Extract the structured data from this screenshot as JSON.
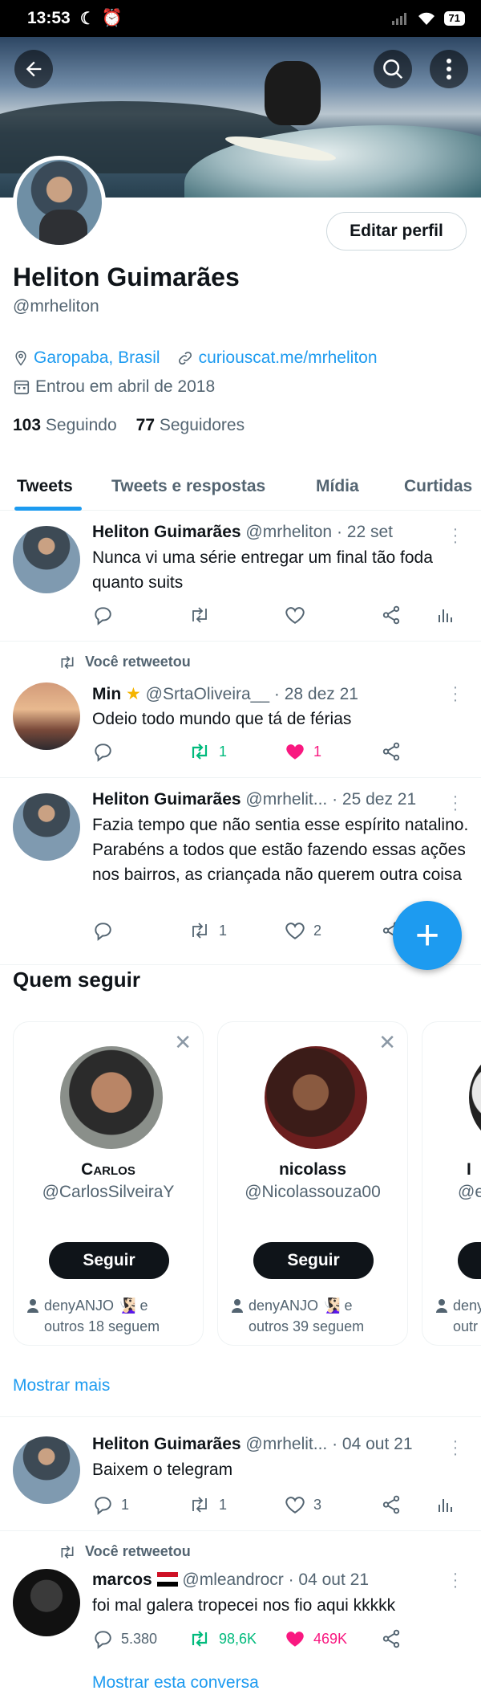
{
  "status_bar": {
    "time": "13:53",
    "battery": "71"
  },
  "profile": {
    "name": "Heliton Guimarães",
    "handle": "@mrheliton",
    "edit_label": "Editar perfil",
    "location": "Garopaba, Brasil",
    "website": "curiouscat.me/mrheliton",
    "joined": "Entrou em abril de 2018",
    "following_count": "103",
    "following_label": "Seguindo",
    "followers_count": "77",
    "followers_label": "Seguidores"
  },
  "tabs": [
    {
      "label": "Tweets"
    },
    {
      "label": "Tweets e respostas"
    },
    {
      "label": "Mídia"
    },
    {
      "label": "Curtidas"
    }
  ],
  "tweets": [
    {
      "name": "Heliton Guimarães",
      "handle": "@mrheliton",
      "date": "· 22 set",
      "text": "Nunca vi uma série entregar um final tão foda quanto suits"
    },
    {
      "retweet_label": "Você retweetou",
      "name": "Min",
      "handle": "@SrtaOliveira__",
      "date": "· 28 dez 21",
      "text": "Odeio todo mundo que tá de férias",
      "retweets": "1",
      "likes": "1"
    },
    {
      "name": "Heliton Guimarães",
      "handle": "@mrhelit...",
      "date": "· 25 dez 21",
      "text": "Fazia tempo que não sentia esse espírito natalino. Parabéns a todos que estão fazendo essas ações nos bairros, as criançada não querem outra coisa",
      "retweets": "1",
      "likes": "2"
    },
    {
      "name": "Heliton Guimarães",
      "handle": "@mrhelit...",
      "date": "· 04 out 21",
      "text": "Baixem o telegram",
      "replies": "1",
      "retweets": "1",
      "likes": "3"
    },
    {
      "retweet_label": "Você retweetou",
      "name": "marcos",
      "handle": "@mleandrocr",
      "date": "· 04 out 21",
      "text": "foi mal galera tropecei nos fio aqui kkkkk",
      "replies": "5.380",
      "retweets": "98,6K",
      "likes": "469K",
      "show_thread": "Mostrar esta conversa"
    }
  ],
  "who_to_follow": {
    "title": "Quem seguir",
    "follow_label": "Seguir",
    "show_more": "Mostrar mais",
    "cards": [
      {
        "name": "Carlos",
        "handle": "@CarlosSilveiraY",
        "context_line1": "denyANJO 🧏🏻‍♀️ e",
        "context_line2": "outros 18 seguem"
      },
      {
        "name": "nicolass",
        "handle": "@Nicolassouza00",
        "context_line1": "denyANJO 🧏🏻‍♀️ e",
        "context_line2": "outros 39 seguem"
      },
      {
        "name": "I",
        "handle": "@e",
        "context_line1": "deny",
        "context_line2": "outr"
      }
    ]
  },
  "colors": {
    "accent": "#1d9bf0",
    "retweet": "#00ba7c",
    "like": "#f91880",
    "text": "#0f1419",
    "muted": "#536471"
  }
}
